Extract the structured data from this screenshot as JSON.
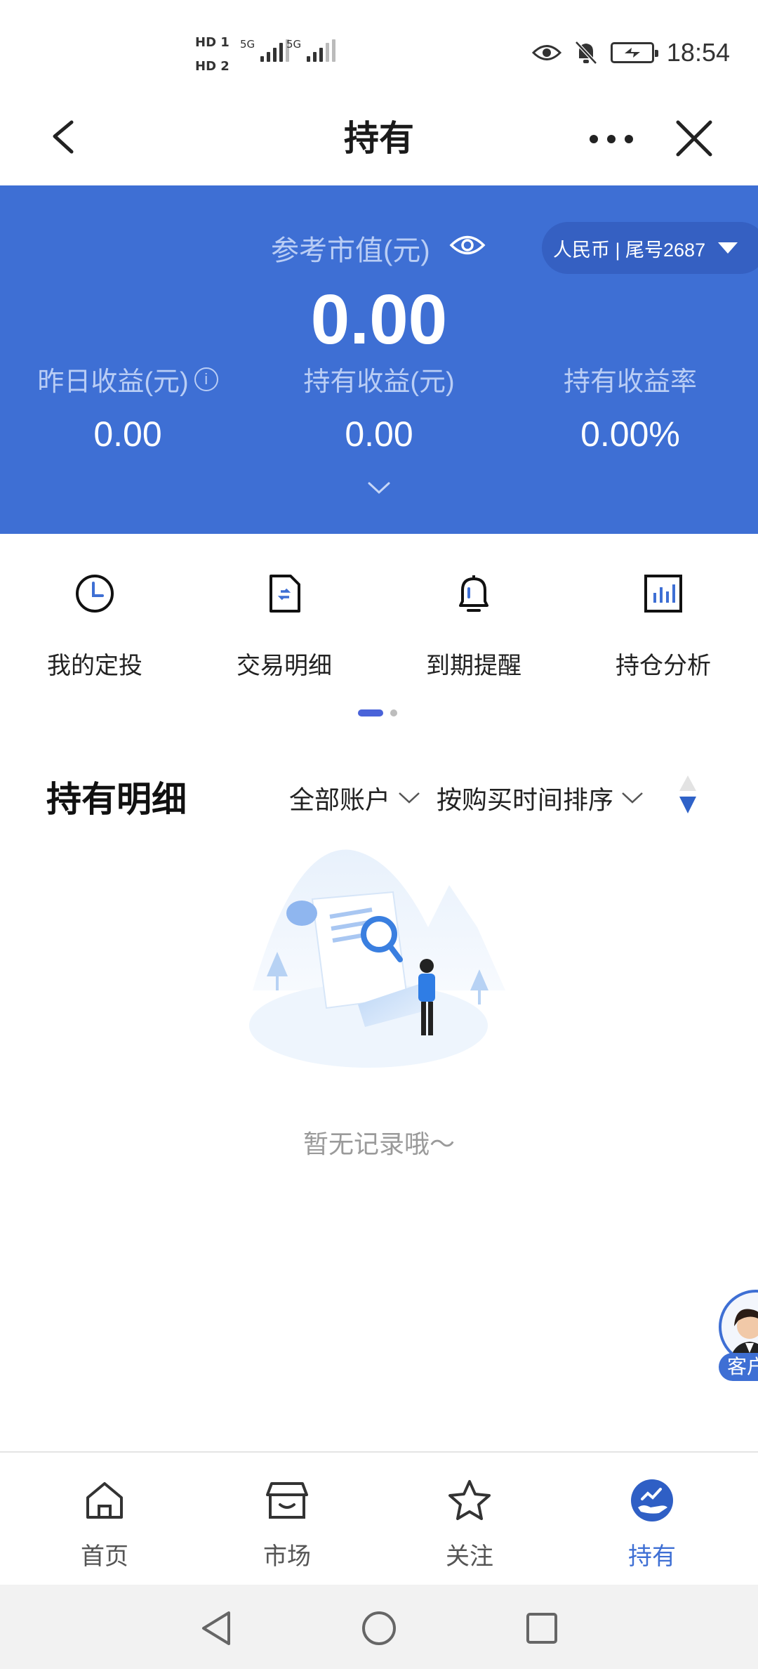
{
  "status_bar": {
    "sim1": "HD 1",
    "sim2": "HD 2",
    "signal1_label": "5G",
    "signal2_label": "5G",
    "time": "18:54",
    "icons": [
      "eye-icon",
      "bell-off-icon",
      "battery-charging-icon"
    ]
  },
  "nav": {
    "title": "持有",
    "back_icon": "chevron-left-icon",
    "more_icon": "more-icon",
    "close_icon": "close-icon"
  },
  "summary": {
    "market_value_label": "参考市值(元)",
    "market_value": "0.00",
    "currency_selector": "人民币 | 尾号2687",
    "stats": [
      {
        "label": "昨日收益(元)",
        "value": "0.00"
      },
      {
        "label": "持有收益(元)",
        "value": "0.00"
      },
      {
        "label": "持有收益率",
        "value": "0.00%"
      }
    ],
    "background_color": "#3e6fd4"
  },
  "quick_actions": [
    {
      "label": "我的定投",
      "icon": "clock-icon"
    },
    {
      "label": "交易明细",
      "icon": "transaction-doc-icon"
    },
    {
      "label": "到期提醒",
      "icon": "bell-icon"
    },
    {
      "label": "持仓分析",
      "icon": "bar-chart-icon"
    }
  ],
  "holdings": {
    "title": "持有明细",
    "account_filter": "全部账户",
    "sort_filter": "按购买时间排序",
    "empty_text": "暂无记录哦～"
  },
  "service": {
    "label": "客户"
  },
  "tab_bar": [
    {
      "label": "首页",
      "icon": "home-icon",
      "active": false
    },
    {
      "label": "市场",
      "icon": "market-icon",
      "active": false
    },
    {
      "label": "关注",
      "icon": "star-icon",
      "active": false
    },
    {
      "label": "持有",
      "icon": "holding-icon",
      "active": true
    }
  ],
  "colors": {
    "accent": "#3e6fd4",
    "active_tab": "#3e6fd4",
    "pager_active": "#4a63d9"
  }
}
